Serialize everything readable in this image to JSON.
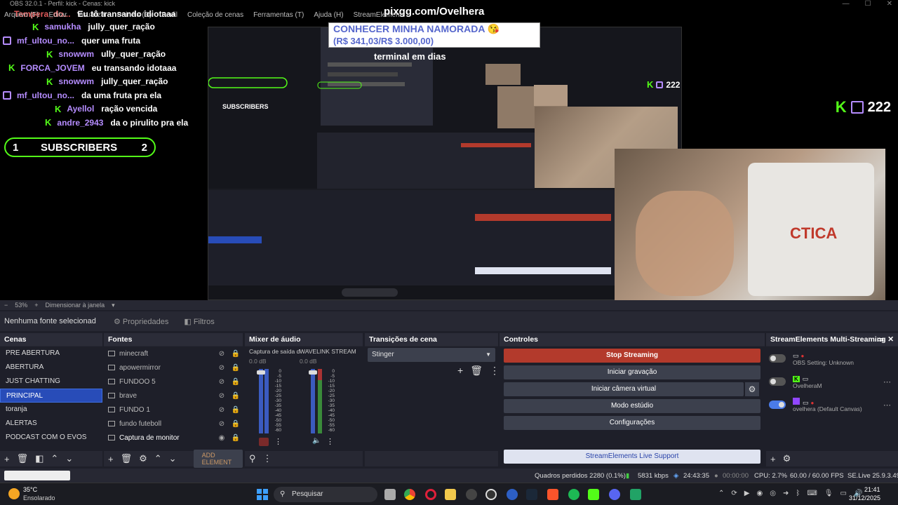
{
  "window": {
    "title": "OBS 32.0.1 - Perfil: kick - Cenas: kick"
  },
  "menu": [
    "Arquivo (F)",
    "Editar",
    "Visualizar",
    "Painéis (D)",
    "Perfil",
    "Coleção de cenas",
    "Ferramentas (T)",
    "Ajuda (H)",
    "StreamElements"
  ],
  "preview": {
    "donation_url": "pixgg.com/Ovelhera",
    "goal_title": "CONHECER MINHA NAMORADA 😘",
    "goal_value": "(R$ 341,03/R$ 3.000,00)",
    "overlay_text": "terminal em dias",
    "top_chat": {
      "user": "Tempera_do...",
      "msg": "Eu tô transando idiotaaa"
    },
    "chat": [
      {
        "platform": "kick",
        "user": "samukha",
        "msg": "jully_quer_ração"
      },
      {
        "platform": "twitch",
        "user": "mf_ultou_no...",
        "msg": "quer uma fruta"
      },
      {
        "platform": "kick",
        "user": "snowwm",
        "msg": "ully_quer_ração"
      },
      {
        "platform": "kick",
        "user": "FORCA_JOVEM",
        "msg": "eu transando idotaaa"
      },
      {
        "platform": "kick",
        "user": "snowwm",
        "msg": "jully_quer_ração"
      },
      {
        "platform": "twitch",
        "user": "mf_ultou_no...",
        "msg": "da uma fruta pra ela"
      },
      {
        "platform": "kick",
        "user": "Ayellol",
        "msg": "ração vencida"
      },
      {
        "platform": "kick",
        "user": "andre_2943",
        "msg": "da o pirulito pra ela"
      }
    ],
    "subs": {
      "left": "1",
      "label": "SUBSCRIBERS",
      "right": "2"
    },
    "viewer_count": "222",
    "camera_text": "CTICA"
  },
  "zoom": {
    "value": "53%",
    "label": "Dimensionar à janela"
  },
  "source_bar": {
    "none_selected": "Nenhuma fonte selecionad",
    "properties": "Propriedades",
    "filters": "Filtros"
  },
  "scenes": {
    "title": "Cenas",
    "items": [
      "PRE ABERTURA",
      "ABERTURA",
      "JUST CHATTING",
      "PRINCIPAL",
      "toranja",
      "ALERTAS",
      "PODCAST COM O EVOS"
    ],
    "selected": "PRINCIPAL"
  },
  "sources": {
    "title": "Fontes",
    "items": [
      "minecraft",
      "apowermirror",
      "FUNDOO 5",
      "brave",
      "FUNDO 1",
      "fundo futeboll",
      "Captura de monitor"
    ],
    "add_element": "ADD ELEMENT"
  },
  "mixer": {
    "title": "Mixer de áudio",
    "channels": [
      {
        "name": "Captura de saída d",
        "db": "0.0 dB"
      },
      {
        "name": "WAVELINK STREAM",
        "db": "0.0 dB"
      }
    ],
    "scale": [
      "0",
      "-5",
      "-10",
      "-15",
      "-20",
      "-25",
      "-30",
      "-35",
      "-40",
      "-45",
      "-50",
      "-55",
      "-60"
    ]
  },
  "transitions": {
    "title": "Transições de cena",
    "selected": "Stinger"
  },
  "controls": {
    "title": "Controles",
    "stop_streaming": "Stop Streaming",
    "start_recording": "Iniciar gravação",
    "virtual_camera": "Iniciar câmera virtual",
    "studio_mode": "Modo estúdio",
    "settings": "Configurações",
    "support": "StreamElements Live Support"
  },
  "multistream": {
    "title": "StreamElements Multi-Streaming",
    "rows": [
      {
        "label": "OBS Setting: Unknown",
        "on": false
      },
      {
        "label": "OvelheraM",
        "on": false
      },
      {
        "label": "ovelhera (Default Canvas)",
        "on": true
      }
    ]
  },
  "status": {
    "dropped": "Quadros perdidos 2280 (0.1%)",
    "bitrate": "5831 kbps",
    "stream_time": "24:43:35",
    "rec_time": "00:00:00",
    "cpu": "CPU: 2.7%",
    "fps": "60.00 / 60.00 FPS",
    "se_version": "SE.Live 25.9.3.493"
  },
  "taskbar": {
    "weather_temp": "35°C",
    "weather_desc": "Ensolarado",
    "search": "Pesquisar",
    "time": "21:41",
    "date": "31/12/2025"
  },
  "colors": {
    "accent_blue": "#284cb8",
    "stop_red": "#b33a2c",
    "kick_green": "#53fc18",
    "twitch_purple": "#b58cff"
  }
}
